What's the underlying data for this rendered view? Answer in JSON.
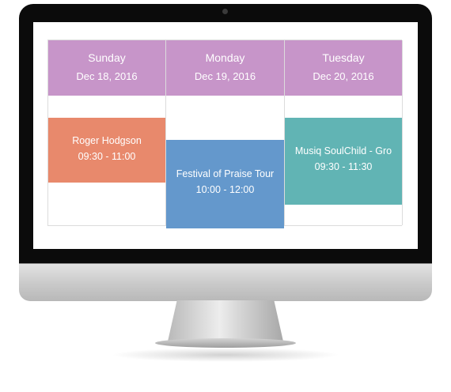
{
  "calendar": {
    "days": [
      {
        "day": "Sunday",
        "date": "Dec 18, 2016"
      },
      {
        "day": "Monday",
        "date": "Dec 19, 2016"
      },
      {
        "day": "Tuesday",
        "date": "Dec 20, 2016"
      }
    ],
    "events": [
      {
        "title": "Roger Hodgson",
        "time": "09:30 - 11:00",
        "color": "#e8896c"
      },
      {
        "title": "Festival of Praise Tour",
        "time": "10:00 - 12:00",
        "color": "#6498cc"
      },
      {
        "title": "Musiq SoulChild - Gro",
        "time": "09:30 - 11:30",
        "color": "#61b4b4"
      }
    ],
    "header_color": "#c795c9"
  }
}
